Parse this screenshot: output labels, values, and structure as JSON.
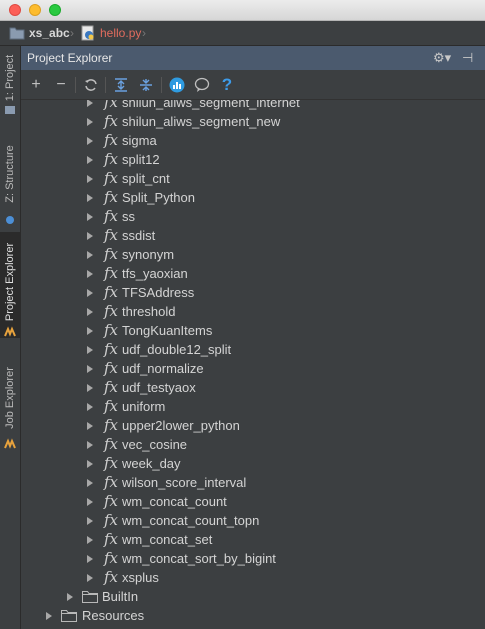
{
  "window": {
    "controls": [
      "close",
      "minimize",
      "maximize"
    ]
  },
  "breadcrumb": {
    "project": "xs_abc",
    "file": "hello.py",
    "file_color": "#e06c5e"
  },
  "side_tabs": [
    {
      "label": "1: Project",
      "icon": "project-icon"
    },
    {
      "label": "Z: Structure",
      "icon": "structure-icon"
    },
    {
      "label": "Project Explorer",
      "icon": "odps-icon",
      "active": true
    },
    {
      "label": "Job Explorer",
      "icon": "odps-icon"
    }
  ],
  "panel": {
    "title": "Project Explorer",
    "header_icons": [
      "gear-icon",
      "hide-panel-icon"
    ],
    "toolbar": [
      "add-icon",
      "remove-icon",
      "refresh-icon",
      "expand-all-icon",
      "collapse-all-icon",
      "analytics-icon",
      "chat-icon",
      "help-icon"
    ],
    "accent": "#4b5a6e"
  },
  "functions": [
    "shilun_aliws_segment_internet",
    "shilun_aliws_segment_new",
    "sigma",
    "split12",
    "split_cnt",
    "Split_Python",
    "ss",
    "ssdist",
    "synonym",
    "tfs_yaoxian",
    "TFSAddress",
    "threshold",
    "TongKuanItems",
    "udf_double12_split",
    "udf_normalize",
    "udf_testyaox",
    "uniform",
    "upper2lower_python",
    "vec_cosine",
    "week_day",
    "wilson_score_interval",
    "wm_concat_count",
    "wm_concat_count_topn",
    "wm_concat_set",
    "wm_concat_sort_by_bigint",
    "xsplus"
  ],
  "function_icon": "fx",
  "folders": [
    {
      "label": "BuiltIn",
      "icon": "folder-icon"
    },
    {
      "label": "Resources",
      "icon": "folder-icon"
    }
  ],
  "toolbar_help": "?"
}
